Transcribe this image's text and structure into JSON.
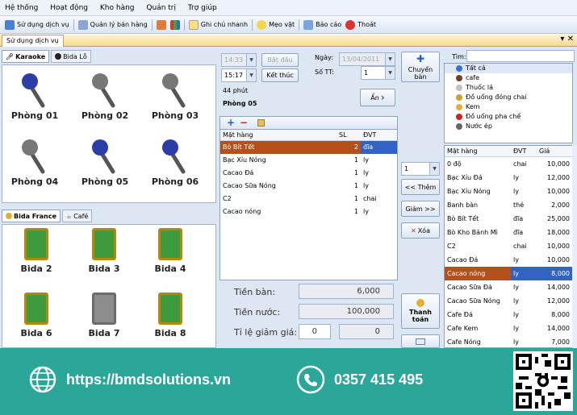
{
  "menu": [
    "Hệ thống",
    "Hoạt động",
    "Kho hàng",
    "Quản trị",
    "Trợ giúp"
  ],
  "toolbar": {
    "items": [
      {
        "label": "Sử dụng dịch vụ",
        "icon": "service-icon"
      },
      {
        "label": "Quản lý bán hàng",
        "icon": "sales-icon"
      },
      {
        "label": "",
        "icon": "calculator-icon"
      },
      {
        "label": "",
        "icon": "chart-icon"
      },
      {
        "label": "Ghi chú nhanh",
        "icon": "note-icon"
      },
      {
        "label": "Mẹo vặt",
        "icon": "bulb-icon"
      },
      {
        "label": "Báo cáo",
        "icon": "report-icon"
      },
      {
        "label": "Thoát",
        "icon": "exit-icon"
      }
    ]
  },
  "panel": {
    "title": "Sử dụng dịch vụ",
    "controls": "▾ ✕"
  },
  "rooms_tabs": {
    "tab1": "Karaoke",
    "tab2": "Bida Lỗ"
  },
  "rooms": [
    "Phòng 01",
    "Phòng 02",
    "Phòng 03",
    "Phòng 04",
    "Phòng 05",
    "Phòng 06"
  ],
  "tables_tabs": {
    "tab1": "Bida France",
    "tab2": "Café"
  },
  "tables": [
    "Bida 2",
    "Bida 3",
    "Bida 4",
    "Bida 6",
    "Bida 7",
    "Bida 8"
  ],
  "session": {
    "start_time": "14:33",
    "start_btn": "Bắt đầu",
    "end_time": "15:17",
    "end_btn": "Kết thúc",
    "duration": "44 phút",
    "room": "Phòng 05",
    "date_label": "Ngày:",
    "date_value": "13/04/2011",
    "number_label": "Số TT:",
    "number_value": "1",
    "hide_btn": "Ẩn",
    "transfer_btn": "Chuyển bàn"
  },
  "order": {
    "headers": [
      "Mặt hàng",
      "SL",
      "ĐVT"
    ],
    "rows": [
      {
        "name": "Bò Bít Tết",
        "qty": "2",
        "unit": "đĩa",
        "selected": true
      },
      {
        "name": "Bạc Xỉu Nóng",
        "qty": "1",
        "unit": "ly"
      },
      {
        "name": "Cacao Đá",
        "qty": "1",
        "unit": "ly"
      },
      {
        "name": "Cacao Sữa Nóng",
        "qty": "1",
        "unit": "ly"
      },
      {
        "name": "C2",
        "qty": "1",
        "unit": "chai"
      },
      {
        "name": "Cacao nóng",
        "qty": "1",
        "unit": "ly"
      }
    ]
  },
  "totals": {
    "room_fee_label": "Tiền bàn:",
    "room_fee": "6,000",
    "drink_fee_label": "Tiền nước:",
    "drink_fee": "100,000",
    "discount_label": "Tỉ lệ giảm giá:",
    "discount_pct": "0",
    "discount_amt": "0"
  },
  "actions": {
    "qty": "1",
    "add": "<< Thêm",
    "decrease": "Giảm >>",
    "delete": "Xóa",
    "pay": "Thanh toán"
  },
  "search": {
    "label": "Tìm:",
    "value": ""
  },
  "categories": [
    {
      "name": "Tất cả",
      "color": "#3b6fd8"
    },
    {
      "name": "cafe",
      "color": "#6b4226"
    },
    {
      "name": "Thuốc lá",
      "color": "#c0c0c0"
    },
    {
      "name": "Đồ uống đóng chai",
      "color": "#caa12a"
    },
    {
      "name": "Kem",
      "color": "#e0b030"
    },
    {
      "name": "Đồ uống pha chế",
      "color": "#c22"
    },
    {
      "name": "Nước ép",
      "color": "#666"
    }
  ],
  "products": {
    "headers": [
      "Mặt hàng",
      "ĐVT",
      "Giá"
    ],
    "rows": [
      {
        "name": "0 độ",
        "unit": "chai",
        "price": "10,000"
      },
      {
        "name": "Bạc Xỉu Đá",
        "unit": "ly",
        "price": "12,000"
      },
      {
        "name": "Bạc Xỉu Nóng",
        "unit": "ly",
        "price": "10,000"
      },
      {
        "name": "Banh bàn",
        "unit": "thẻ",
        "price": "2,000"
      },
      {
        "name": "Bò Bít Tết",
        "unit": "đĩa",
        "price": "25,000"
      },
      {
        "name": "Bò Kho Bánh Mì",
        "unit": "đĩa",
        "price": "18,000"
      },
      {
        "name": "C2",
        "unit": "chai",
        "price": "10,000"
      },
      {
        "name": "Cacao Đá",
        "unit": "ly",
        "price": "10,000"
      },
      {
        "name": "Cacao nóng",
        "unit": "ly",
        "price": "8,000",
        "selected": true
      },
      {
        "name": "Cacao Sữa Đá",
        "unit": "ly",
        "price": "14,000"
      },
      {
        "name": "Cacao Sữa Nóng",
        "unit": "ly",
        "price": "12,000"
      },
      {
        "name": "Cafe Đá",
        "unit": "ly",
        "price": "8,000"
      },
      {
        "name": "Cafe Kem",
        "unit": "ly",
        "price": "14,000"
      },
      {
        "name": "Cafe Nóng",
        "unit": "ly",
        "price": "7,000"
      }
    ]
  },
  "footer": {
    "website": "https://bmdsolutions.vn",
    "phone": "0357 415 495",
    "bg": "#2ba79a"
  }
}
